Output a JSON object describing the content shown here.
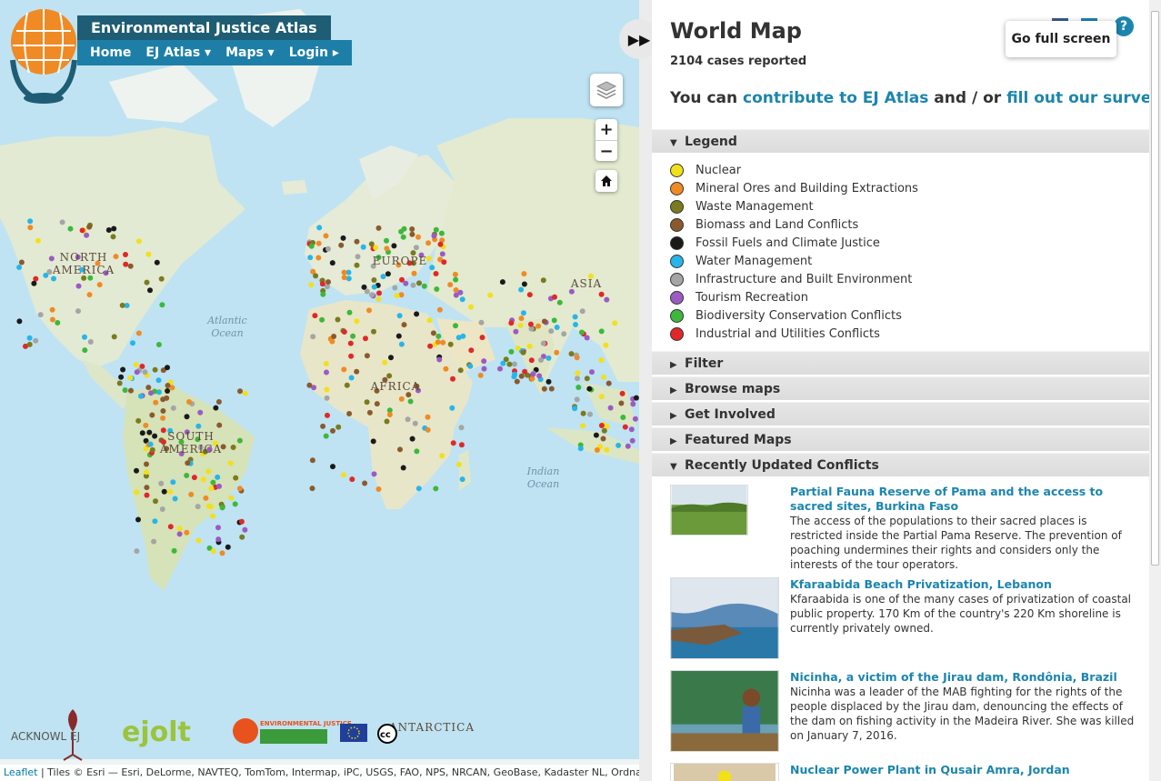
{
  "header": {
    "site_title": "Environmental Justice Atlas",
    "nav": [
      "Home",
      "EJ Atlas ▾",
      "Maps ▾",
      "Login ▸"
    ]
  },
  "map": {
    "continents": [
      "NORTH\nAMERICA",
      "EUROPE",
      "ASIA",
      "AFRICA",
      "SOUTH\nAMERICA",
      "ANTARCTICA"
    ],
    "oceans": [
      "Atlantic\nOcean",
      "Indian\nOcean"
    ],
    "zoom_in": "+",
    "zoom_out": "−",
    "controls": {
      "layers": "layers-icon",
      "home": "home-icon"
    },
    "partner_logos": [
      "ACKNOWL EJ",
      "ejolt",
      "ENVIRONMENTAL JUSTICE"
    ],
    "attribution_link": "Leaflet",
    "attribution_text": " | Tiles © Esri — Esri, DeLorme, NAVTEQ, TomTom, Intermap, iPC, USGS, FAO, NPS, NRCAN, GeoBase, Kadaster NL, Ordnance"
  },
  "panel": {
    "title": "World Map",
    "cases": "2104 cases reported",
    "contribute_prefix": "You can ",
    "contribute_link": "contribute to EJ Atlas",
    "contribute_mid": " and / or ",
    "survey_link": "fill out our survey.",
    "full_screen": "Go full screen",
    "help": "?",
    "sections": {
      "legend": "Legend",
      "filter": "Filter",
      "browse": "Browse maps",
      "involved": "Get Involved",
      "featured": "Featured Maps",
      "recent": "Recently Updated Conflicts"
    },
    "legend": [
      {
        "label": "Nuclear",
        "color": "#f2e01a",
        "icon": "nuclear-icon"
      },
      {
        "label": "Mineral Ores and Building Extractions",
        "color": "#f08a24",
        "icon": "mineral-icon"
      },
      {
        "label": "Waste Management",
        "color": "#7a7a1e",
        "icon": "waste-icon"
      },
      {
        "label": "Biomass and Land Conflicts",
        "color": "#8a5a2e",
        "icon": "biomass-icon"
      },
      {
        "label": "Fossil Fuels and Climate Justice",
        "color": "#1a1a1a",
        "icon": "fossil-icon"
      },
      {
        "label": "Water Management",
        "color": "#27b5ea",
        "icon": "water-icon"
      },
      {
        "label": "Infrastructure and Built Environment",
        "color": "#a5a5a5",
        "icon": "infrastructure-icon"
      },
      {
        "label": "Tourism Recreation",
        "color": "#9b5bc2",
        "icon": "tourism-icon"
      },
      {
        "label": "Biodiversity Conservation Conflicts",
        "color": "#3cb83c",
        "icon": "biodiversity-icon"
      },
      {
        "label": "Industrial and Utilities Conflicts",
        "color": "#e02828",
        "icon": "industrial-icon"
      }
    ],
    "conflicts": [
      {
        "title": "Partial Fauna Reserve of Pama and the access to sacred sites, Burkina Faso",
        "desc": "The access of the populations to their sacred places is restricted inside the Partial Pama Reserve. The prevention of poaching undermines their rights and considers only the interests of the tour operators."
      },
      {
        "title": "Kfaraabida Beach Privatization, Lebanon",
        "desc": "Kfaraabida is one of the many cases of privatization of coastal public property. 170 Km of the country's 220 Km shoreline is currently privately owned."
      },
      {
        "title": "Nicinha, a victim of the Jirau dam, Rondônia, Brazil",
        "desc": "Nicinha was a leader of the MAB fighting for the rights of the people displaced by the Jirau dam, denouncing the effects of the dam on fishing activity in the Madeira River. She was killed on January 7, 2016."
      },
      {
        "title": "Nuclear Power Plant in Qusair Amra, Jordan",
        "desc": ""
      }
    ]
  }
}
